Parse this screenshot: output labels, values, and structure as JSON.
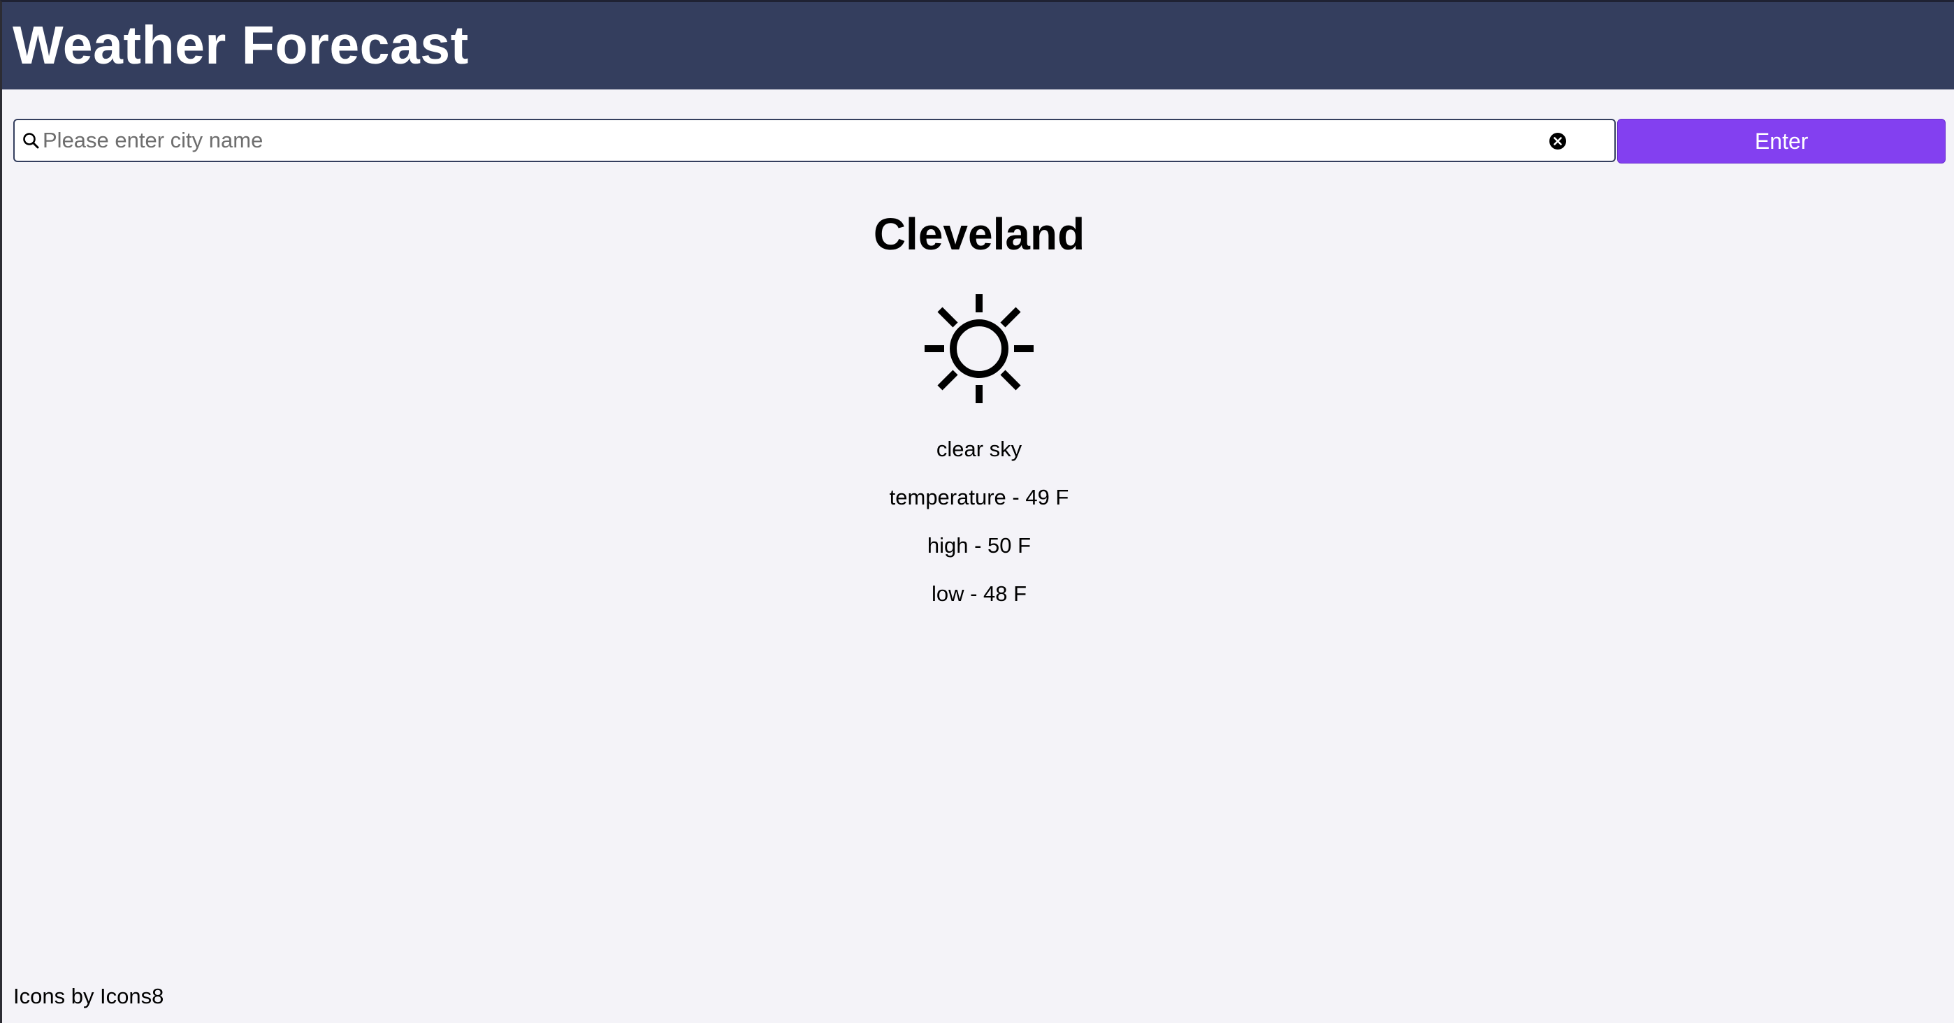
{
  "header": {
    "title": "Weather Forecast"
  },
  "search": {
    "placeholder": "Please enter city name",
    "value": "",
    "search_icon": "search-icon",
    "clear_icon": "clear-icon",
    "button_label": "Enter"
  },
  "weather": {
    "city": "Cleveland",
    "icon": "sun-icon",
    "description": "clear sky",
    "temperature": "temperature - 49 F",
    "high": "high - 50 F",
    "low": "low - 48 F"
  },
  "footer": {
    "credit": "Icons by Icons8"
  },
  "colors": {
    "header_bg": "#343e5e",
    "button_bg": "#8340f0",
    "page_bg": "#f4f3f8"
  }
}
